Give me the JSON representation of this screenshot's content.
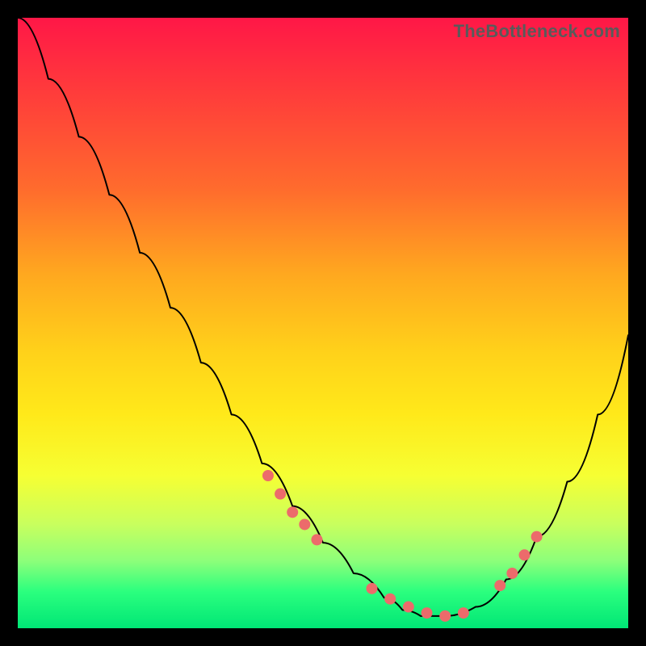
{
  "watermark": {
    "text": "TheBottleneck.com"
  },
  "chart_data": {
    "type": "line",
    "title": "",
    "xlabel": "",
    "ylabel": "",
    "xlim": [
      0,
      100
    ],
    "ylim": [
      0,
      100
    ],
    "grid": false,
    "legend": false,
    "series": [
      {
        "name": "bottleneck-curve",
        "x": [
          0,
          5,
          10,
          15,
          20,
          25,
          30,
          35,
          40,
          45,
          50,
          55,
          60,
          63,
          66,
          70,
          75,
          80,
          85,
          90,
          95,
          100
        ],
        "y": [
          100,
          90,
          80.5,
          71,
          61.5,
          52.5,
          43.5,
          35,
          27,
          20,
          14,
          9,
          5,
          3,
          2,
          2,
          3.5,
          8,
          15,
          24,
          35,
          48
        ]
      }
    ],
    "markers": {
      "name": "highlight-points",
      "x": [
        41,
        43,
        45,
        47,
        49,
        58,
        61,
        64,
        67,
        70,
        73,
        79,
        81,
        83,
        85
      ],
      "y": [
        25,
        22,
        19,
        17,
        14.5,
        6.5,
        4.8,
        3.5,
        2.5,
        2,
        2.5,
        7,
        9,
        12,
        15
      ]
    },
    "gradient_stops": [
      {
        "pos": 0,
        "color": "#ff1747"
      },
      {
        "pos": 12,
        "color": "#ff3b3b"
      },
      {
        "pos": 28,
        "color": "#ff6b2d"
      },
      {
        "pos": 42,
        "color": "#ffa81f"
      },
      {
        "pos": 55,
        "color": "#ffd21a"
      },
      {
        "pos": 65,
        "color": "#ffe91a"
      },
      {
        "pos": 75,
        "color": "#f6ff33"
      },
      {
        "pos": 83,
        "color": "#c8ff5e"
      },
      {
        "pos": 89,
        "color": "#8cff7a"
      },
      {
        "pos": 94,
        "color": "#2bff7e"
      },
      {
        "pos": 100,
        "color": "#00e676"
      }
    ]
  }
}
